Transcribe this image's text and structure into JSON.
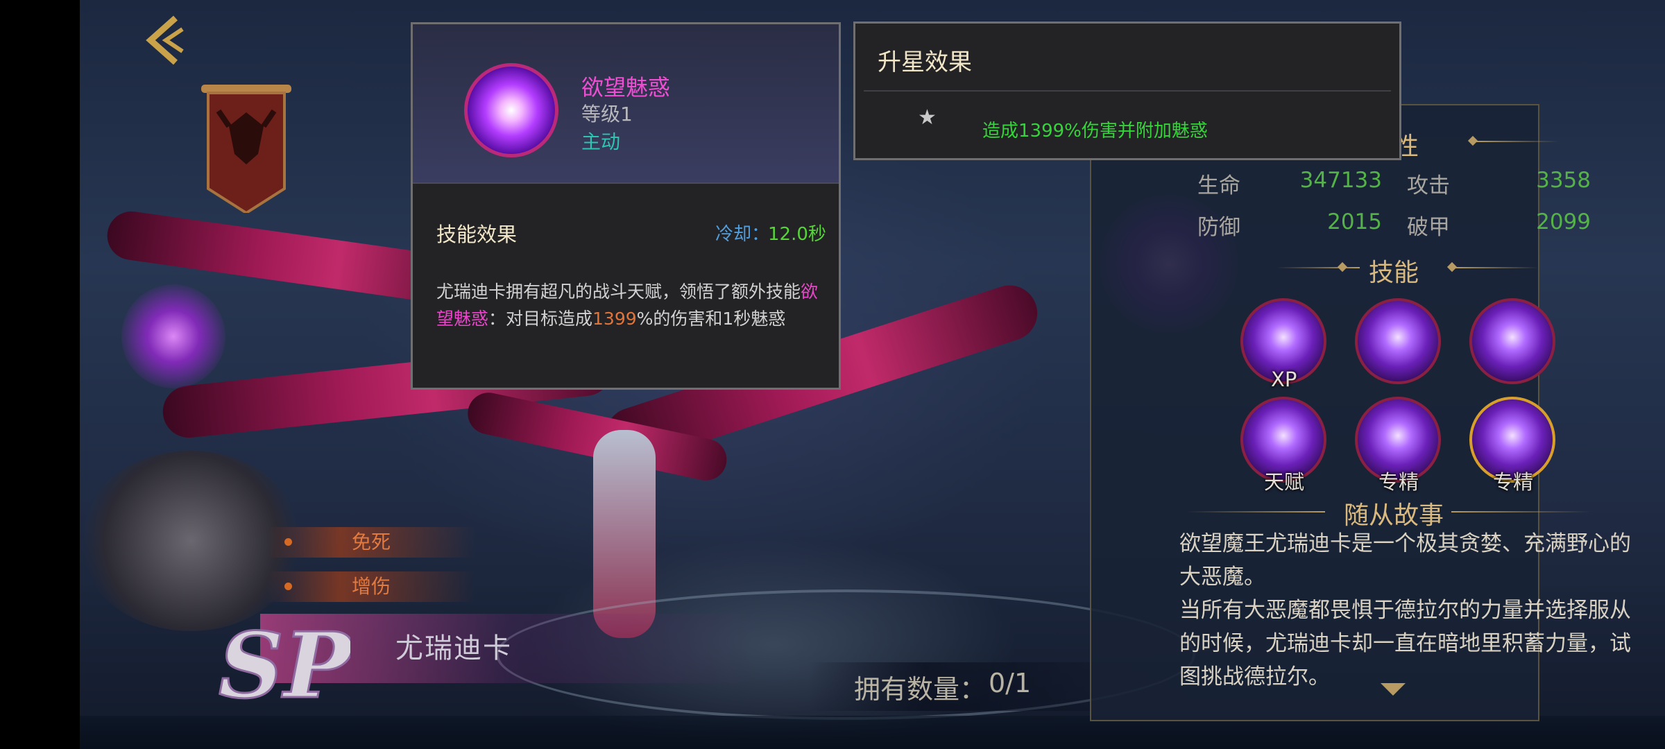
{
  "hero": {
    "name": "尤瑞迪卡",
    "rarity_badge": "SP",
    "status_tags": [
      "免死",
      "增伤"
    ],
    "owned_label": "拥有数量：",
    "owned_value": "0/1"
  },
  "skill_popup": {
    "name": "欲望魅惑",
    "level": "等级1",
    "type": "主动",
    "effect_title": "技能效果",
    "cooldown_label": "冷却：",
    "cooldown_value": "12.0秒",
    "desc_part1": "尤瑞迪卡拥有超凡的战斗天赋，领悟了额外技能",
    "desc_highlight_name": "欲望魅惑",
    "desc_part2": "：对目标造成",
    "desc_highlight_value": "1399",
    "desc_part3": "%的伤害和1秒魅惑"
  },
  "star_popup": {
    "title": "升星效果",
    "star_icon": "★",
    "effect": "造成1399%伤害并附加魅惑"
  },
  "info_panel": {
    "attributes_title": "属性",
    "stats": [
      {
        "label": "生命",
        "value": "347133"
      },
      {
        "label": "攻击",
        "value": "3358"
      },
      {
        "label": "防御",
        "value": "2015"
      },
      {
        "label": "破甲",
        "value": "2099"
      }
    ],
    "skills_title": "技能",
    "skills": [
      {
        "tag": "XP",
        "icon": "xp-skill-icon"
      },
      {
        "tag": "",
        "icon": "skill-2-icon"
      },
      {
        "tag": "",
        "icon": "skill-3-icon"
      },
      {
        "tag": "天赋",
        "icon": "talent-skill-icon"
      },
      {
        "tag": "专精",
        "icon": "mastery-skill-icon"
      },
      {
        "tag": "专精",
        "icon": "mastery-skill-gold-icon"
      }
    ],
    "story_title": "随从故事",
    "story_p1": "欲望魔王尤瑞迪卡是一个极其贪婪、充满野心的大恶魔。",
    "story_p2": "当所有大恶魔都畏惧于德拉尔的力量并选择服从的时候，尤瑞迪卡却一直在暗地里积蓄力量，试图挑战德拉尔。"
  },
  "colors": {
    "accent_gold": "#d9b97e",
    "stat_green": "#55b248",
    "skill_pink": "#ee4fd2",
    "effect_green": "#35d53a"
  }
}
